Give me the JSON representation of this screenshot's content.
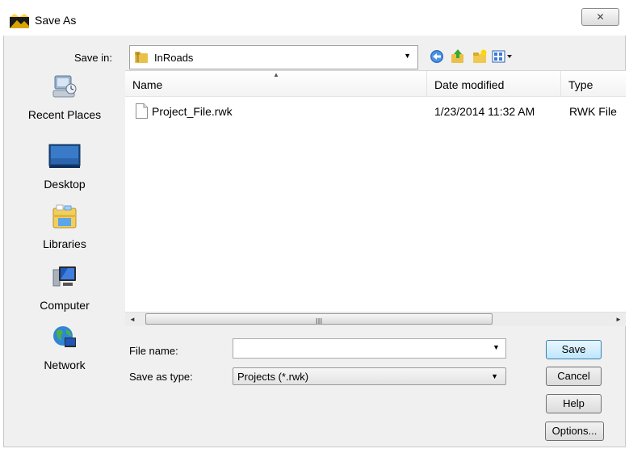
{
  "window": {
    "title": "Save As",
    "close_glyph": "✕"
  },
  "save_in": {
    "label": "Save in:",
    "value": "InRoads",
    "toolbar_icons": [
      "back-icon",
      "up-folder-icon",
      "new-folder-icon",
      "views-menu-icon"
    ]
  },
  "places": [
    {
      "label": "Recent Places",
      "icon": "recent-places-icon"
    },
    {
      "label": "Desktop",
      "icon": "desktop-icon"
    },
    {
      "label": "Libraries",
      "icon": "libraries-icon"
    },
    {
      "label": "Computer",
      "icon": "computer-icon"
    },
    {
      "label": "Network",
      "icon": "network-icon"
    }
  ],
  "file_list": {
    "columns": [
      "Name",
      "Date modified",
      "Type"
    ],
    "rows": [
      {
        "name": "Project_File.rwk",
        "date": "1/23/2014 11:32 AM",
        "type": "RWK File"
      }
    ],
    "scroll_grip": "III"
  },
  "file_name": {
    "label": "File name:",
    "value": ""
  },
  "save_as_type": {
    "label": "Save as type:",
    "value": "Projects (*.rwk)"
  },
  "buttons": {
    "save": "Save",
    "cancel": "Cancel",
    "help": "Help",
    "options": "Options..."
  },
  "colors": {
    "dialog_bg": "#f0f0f0",
    "default_button": "#bee6fd",
    "folder_yellow": "#e9c14a"
  }
}
